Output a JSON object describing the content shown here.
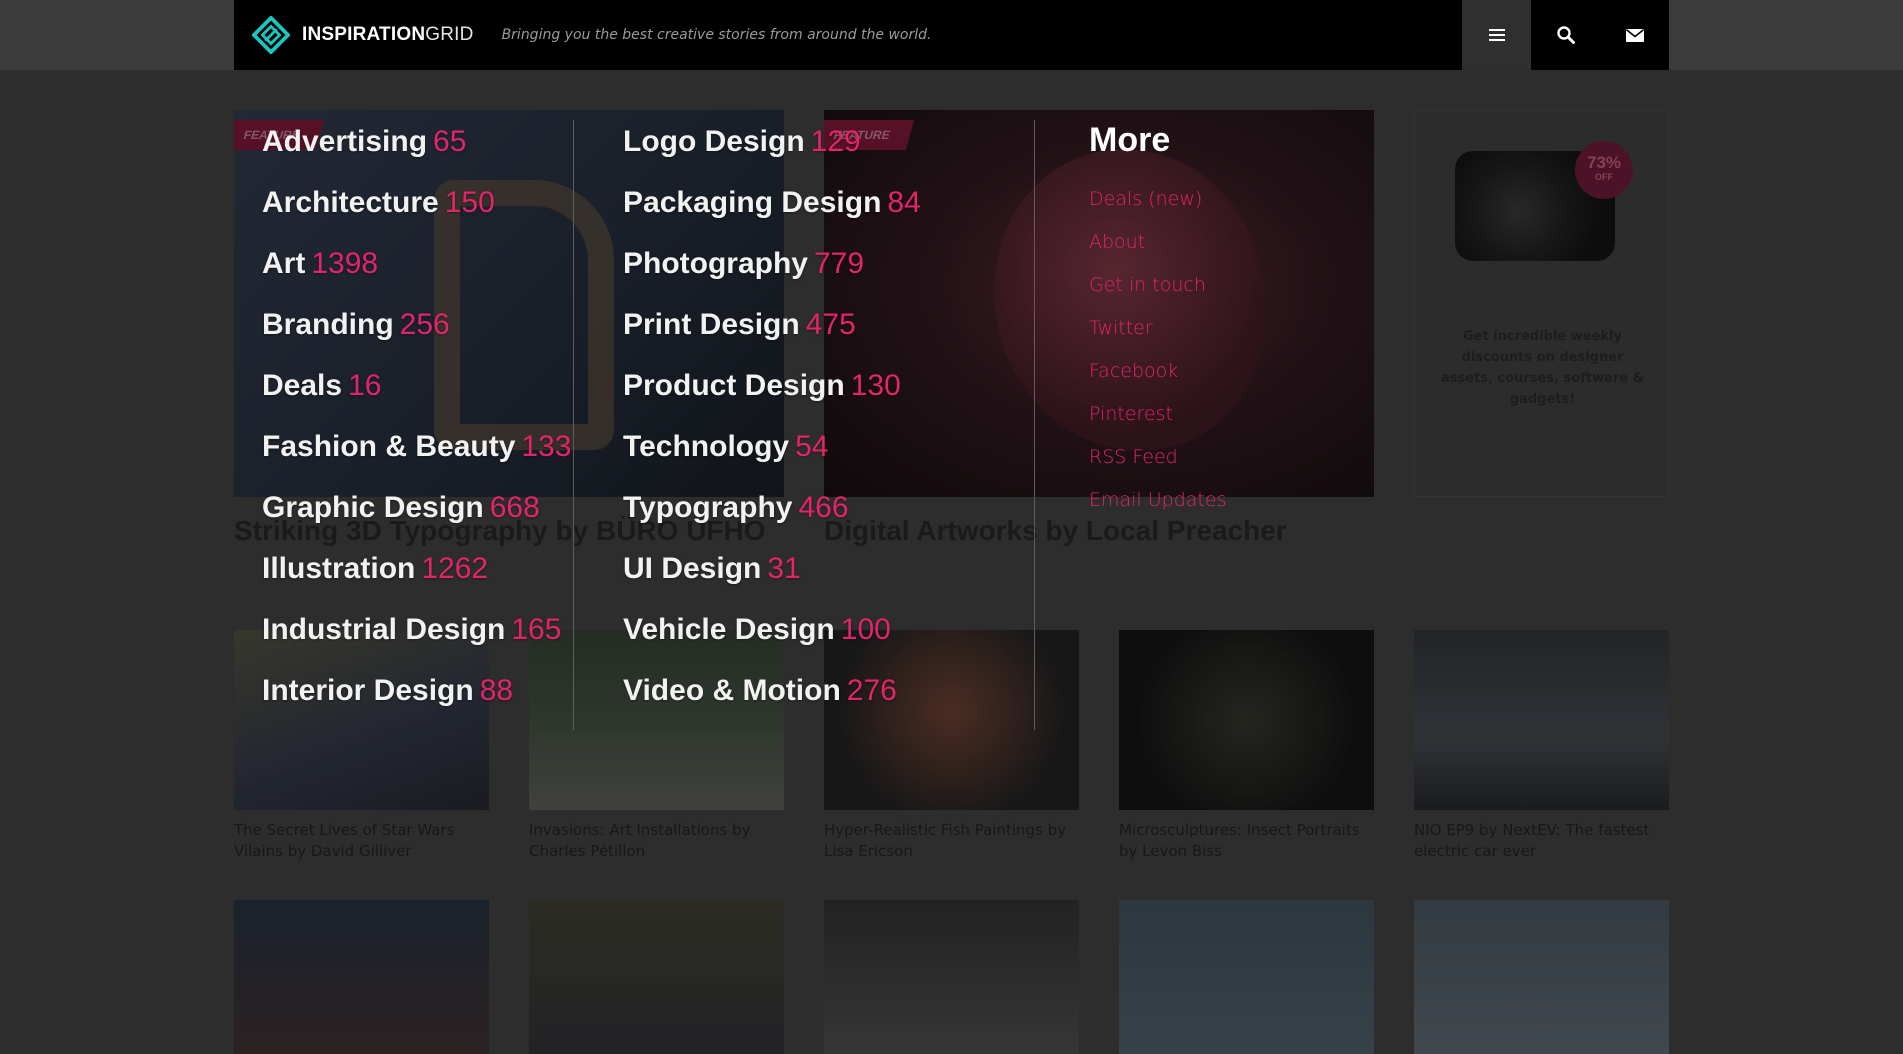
{
  "header": {
    "logo_bold": "INSPIRATION",
    "logo_light": "GRID",
    "tagline": "Bringing you the best creative stories from around the world.",
    "buttons": {
      "menu_icon": "menu-icon",
      "search_icon": "search-icon",
      "mail_icon": "mail-icon"
    }
  },
  "menu": {
    "column1": [
      {
        "label": "Advertising",
        "count": "65"
      },
      {
        "label": "Architecture",
        "count": "150"
      },
      {
        "label": "Art",
        "count": "1398"
      },
      {
        "label": "Branding",
        "count": "256"
      },
      {
        "label": "Deals",
        "count": "16"
      },
      {
        "label": "Fashion & Beauty",
        "count": "133"
      },
      {
        "label": "Graphic Design",
        "count": "668"
      },
      {
        "label": "Illustration",
        "count": "1262"
      },
      {
        "label": "Industrial Design",
        "count": "165"
      },
      {
        "label": "Interior Design",
        "count": "88"
      }
    ],
    "column2": [
      {
        "label": "Logo Design",
        "count": "129"
      },
      {
        "label": "Packaging Design",
        "count": "84"
      },
      {
        "label": "Photography",
        "count": "779"
      },
      {
        "label": "Print Design",
        "count": "475"
      },
      {
        "label": "Product Design",
        "count": "130"
      },
      {
        "label": "Technology",
        "count": "54"
      },
      {
        "label": "Typography",
        "count": "466"
      },
      {
        "label": "UI Design",
        "count": "31"
      },
      {
        "label": "Vehicle Design",
        "count": "100"
      },
      {
        "label": "Video & Motion",
        "count": "276"
      }
    ],
    "more": {
      "title": "More",
      "links": [
        "Deals (new)",
        "About",
        "Get in touch",
        "Twitter",
        "Facebook",
        "Pinterest",
        "RSS Feed",
        "Email Updates"
      ]
    }
  },
  "background": {
    "featured": [
      {
        "label": "FEATURE",
        "title": "Striking 3D Typography by BÜRO UFHO"
      },
      {
        "label": "FEATURE",
        "title": "Digital Artworks by Local Preacher"
      }
    ],
    "ad": {
      "discount": "73%",
      "off": "OFF",
      "text": "Get incredible weekly discounts on designer assets, courses, software & gadgets!"
    },
    "posts": [
      "The Secret Lives of Star Wars Vilains by David Gilliver",
      "Invasions: Art Installations by Charles Pétillon",
      "Hyper-Realistic Fish Paintings by Lisa Ericson",
      "Microsculptures: Insect Portraits by Levon Biss",
      "NIO EP9 by NextEV: The fastest electric car ever"
    ]
  },
  "colors": {
    "accent": "#e2256a",
    "brand": "#1bc6c0",
    "header_bg": "#000000"
  }
}
